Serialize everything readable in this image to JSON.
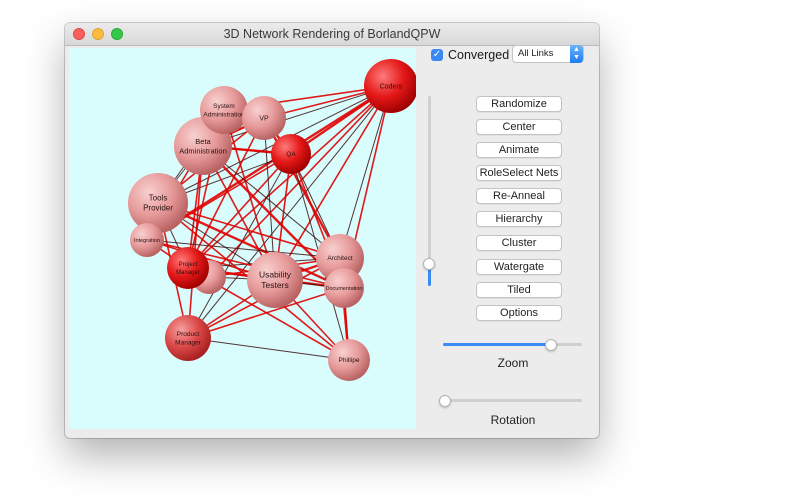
{
  "window": {
    "title": "3D Network Rendering of BorlandQPW"
  },
  "controls": {
    "converged_label": "Converged",
    "converged_checked": true,
    "links_select_value": "All Links",
    "buttons": [
      "Randomize",
      "Center",
      "Animate",
      "RoleSelect Nets",
      "Re-Anneal",
      "Hierarchy",
      "Cluster",
      "Watergate",
      "Tiled",
      "Options"
    ],
    "zoom_label": "Zoom",
    "zoom_value": 0.78,
    "rotation_label": "Rotation",
    "rotation_value": 0.0,
    "vertical_slider_value": 0.12
  },
  "colors": {
    "canvas_bg": "#d9fcfd",
    "accent": "#3a8bf3",
    "link_red": "#e00000",
    "link_dark": "#3a1010"
  },
  "network": {
    "nodes": [
      {
        "id": "coders",
        "label": [
          "Coders"
        ]
      },
      {
        "id": "sysadmin",
        "label": [
          "System",
          "Administration"
        ]
      },
      {
        "id": "vp",
        "label": [
          "VP"
        ]
      },
      {
        "id": "beta",
        "label": [
          "Beta",
          "Administration"
        ]
      },
      {
        "id": "qa",
        "label": [
          "QA"
        ]
      },
      {
        "id": "tools",
        "label": [
          "Tools",
          "Provider"
        ]
      },
      {
        "id": "integration",
        "label": [
          "Integration"
        ]
      },
      {
        "id": "pm",
        "label": [
          "Project",
          "Manager"
        ]
      },
      {
        "id": "hidden",
        "label": []
      },
      {
        "id": "usability",
        "label": [
          "Usability",
          "Testers"
        ]
      },
      {
        "id": "architect",
        "label": [
          "Architect"
        ]
      },
      {
        "id": "docs",
        "label": [
          "Documentation"
        ]
      },
      {
        "id": "prodmgr",
        "label": [
          "Product",
          "Manager"
        ]
      },
      {
        "id": "phillipe",
        "label": [
          "Phillipe"
        ]
      }
    ]
  }
}
